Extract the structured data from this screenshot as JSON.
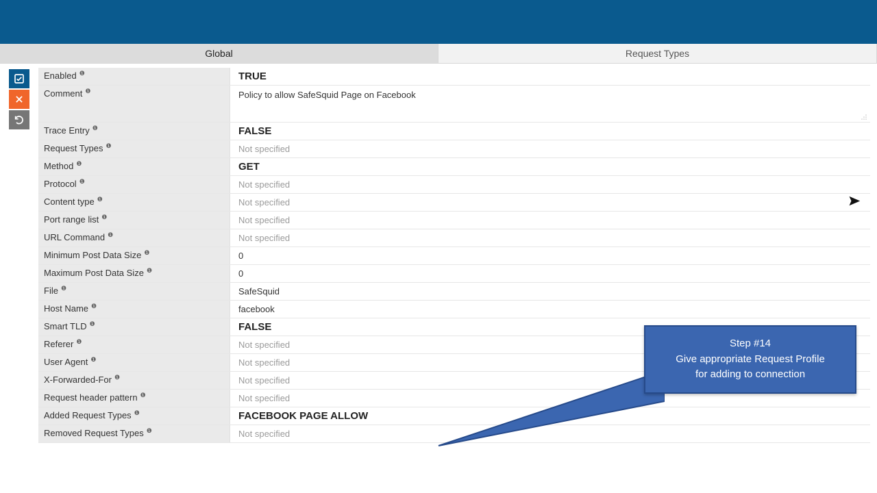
{
  "tabs": {
    "global": "Global",
    "request_types": "Request Types"
  },
  "actions": {
    "check": "confirm",
    "close": "cancel",
    "undo": "undo"
  },
  "form": {
    "enabled": {
      "label": "Enabled",
      "value": "TRUE"
    },
    "comment": {
      "label": "Comment",
      "value": "Policy to allow SafeSquid Page on Facebook"
    },
    "trace_entry": {
      "label": "Trace Entry",
      "value": "FALSE"
    },
    "request_types": {
      "label": "Request Types",
      "value": "Not specified"
    },
    "method": {
      "label": "Method",
      "value": "GET"
    },
    "protocol": {
      "label": "Protocol",
      "value": "Not specified"
    },
    "content_type": {
      "label": "Content type",
      "value": "Not specified"
    },
    "port_range_list": {
      "label": "Port range list",
      "value": "Not specified"
    },
    "url_command": {
      "label": "URL Command",
      "value": "Not specified"
    },
    "min_post_size": {
      "label": "Minimum Post Data Size",
      "value": "0"
    },
    "max_post_size": {
      "label": "Maximum Post Data Size",
      "value": "0"
    },
    "file": {
      "label": "File",
      "value": "SafeSquid"
    },
    "host_name": {
      "label": "Host Name",
      "value": "facebook"
    },
    "smart_tld": {
      "label": "Smart TLD",
      "value": "FALSE"
    },
    "referer": {
      "label": "Referer",
      "value": "Not specified"
    },
    "user_agent": {
      "label": "User Agent",
      "value": "Not specified"
    },
    "x_forwarded_for": {
      "label": "X-Forwarded-For",
      "value": "Not specified"
    },
    "req_header_pattern": {
      "label": "Request header pattern",
      "value": "Not specified"
    },
    "added_req_types": {
      "label": "Added Request Types",
      "value": "FACEBOOK PAGE ALLOW"
    },
    "removed_req_types": {
      "label": "Removed Request Types",
      "value": "Not specified"
    }
  },
  "callout": {
    "title": "Step #14",
    "line1": "Give appropriate Request Profile",
    "line2": "for adding to connection"
  }
}
